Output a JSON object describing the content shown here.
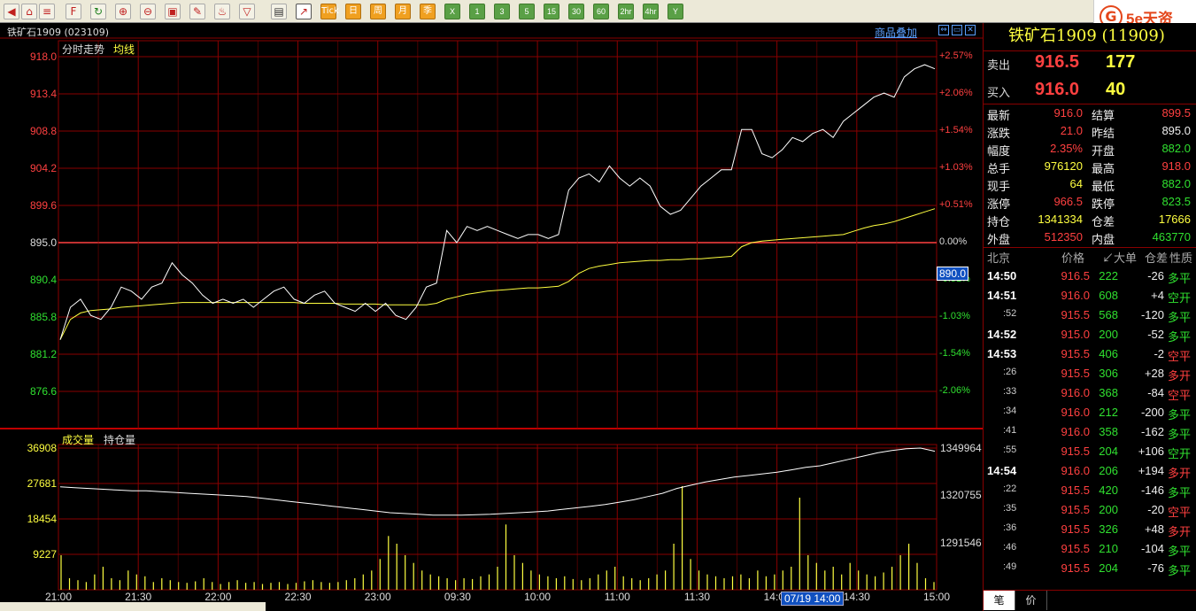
{
  "toolbar": {
    "period_buttons": [
      "Tick",
      "日",
      "周",
      "月",
      "季",
      "X",
      "1",
      "3",
      "5",
      "15",
      "30",
      "60",
      "2hr",
      "4hr",
      "Y"
    ]
  },
  "logo": {
    "mark": "G",
    "text": "5e天资"
  },
  "chart_header": {
    "title": "铁矿石1909 (023109)",
    "overlay_link": "商品叠加",
    "trend_label": "分时走势",
    "avg_label": "均线",
    "volume_label": "成交量",
    "oi_label": "持仓量"
  },
  "colors": {
    "up": "#ff4040",
    "down": "#30e030",
    "avg": "#ffff40",
    "price": "#ffffff",
    "grid": "#8a0000"
  },
  "chart_data": [
    {
      "type": "line",
      "name": "price",
      "y_ticks": [
        "918.0",
        "913.4",
        "908.8",
        "904.2",
        "899.6",
        "895.0",
        "890.4",
        "885.8",
        "881.2",
        "876.6"
      ],
      "pct_ticks": [
        "+2.57%",
        "+2.06%",
        "+1.54%",
        "+1.03%",
        "+0.51%",
        "0.00%",
        "-0.51%",
        "-1.03%",
        "-1.54%",
        "-2.06%"
      ],
      "ylim": [
        872.0,
        918.0
      ],
      "base": 895.0,
      "x_ticks": [
        "21:00",
        "21:30",
        "22:00",
        "22:30",
        "23:00",
        "09:30",
        "10:00",
        "11:00",
        "11:30",
        "14:00",
        "14:30",
        "15:00"
      ],
      "price_series": [
        883,
        887,
        888,
        886,
        885.5,
        887,
        889.5,
        889,
        888,
        889.5,
        890,
        892.5,
        891,
        890,
        888.5,
        887.5,
        888,
        887.5,
        888,
        887,
        888,
        889,
        889.5,
        888,
        887.5,
        888.5,
        889,
        887.5,
        887,
        886.5,
        887.5,
        886.5,
        887.5,
        886,
        885.5,
        887,
        889.5,
        890,
        896.5,
        895,
        897,
        896.5,
        897,
        896.5,
        896,
        895.5,
        896,
        896,
        895.5,
        896,
        901.5,
        903,
        903.5,
        902.5,
        904.5,
        903,
        902,
        903,
        902,
        899.5,
        898.5,
        899,
        900.5,
        902,
        903,
        904,
        904,
        909,
        909,
        906,
        905.5,
        906.5,
        908,
        907.5,
        908.5,
        909,
        908,
        910,
        911,
        912,
        913,
        913.5,
        913,
        915.5,
        916.5,
        917,
        916.5
      ],
      "avg_series": [
        883,
        885.5,
        886.3,
        886.6,
        886.7,
        886.8,
        887.0,
        887.1,
        887.2,
        887.3,
        887.4,
        887.5,
        887.6,
        887.6,
        887.6,
        887.6,
        887.6,
        887.6,
        887.6,
        887.6,
        887.6,
        887.6,
        887.6,
        887.6,
        887.5,
        887.5,
        887.5,
        887.5,
        887.4,
        887.4,
        887.4,
        887.4,
        887.3,
        887.3,
        887.3,
        887.3,
        887.3,
        887.5,
        888.0,
        888.3,
        888.6,
        888.8,
        889.0,
        889.1,
        889.2,
        889.3,
        889.4,
        889.4,
        889.5,
        889.6,
        890.2,
        891.2,
        891.8,
        892.1,
        892.3,
        892.5,
        892.6,
        892.7,
        892.8,
        892.8,
        892.9,
        892.9,
        893.0,
        893.0,
        893.1,
        893.2,
        893.3,
        894.5,
        895.0,
        895.2,
        895.3,
        895.4,
        895.5,
        895.6,
        895.7,
        895.8,
        895.9,
        896.0,
        896.4,
        896.8,
        897.1,
        897.3,
        897.6,
        898.0,
        898.4,
        898.8,
        899.2
      ]
    },
    {
      "type": "bar",
      "name": "volume",
      "y_ticks": [
        "36908",
        "27681",
        "18454",
        "9227"
      ],
      "ylim": [
        0,
        36908
      ],
      "oi_ticks": [
        "1349964",
        "1320755",
        "1291546"
      ],
      "oi_ylim": [
        1262337,
        1349964
      ],
      "oi_series": [
        1326000,
        1325500,
        1325000,
        1324500,
        1324000,
        1323500,
        1323500,
        1323000,
        1322500,
        1322000,
        1321500,
        1321000,
        1320500,
        1320000,
        1319000,
        1318000,
        1317000,
        1316000,
        1315000,
        1314000,
        1313000,
        1312000,
        1311000,
        1310000,
        1309500,
        1309000,
        1308500,
        1308500,
        1308500,
        1308700,
        1309000,
        1309500,
        1310000,
        1310500,
        1311000,
        1312000,
        1313000,
        1314000,
        1315000,
        1316500,
        1318000,
        1320000,
        1322000,
        1325000,
        1327000,
        1329000,
        1330500,
        1332000,
        1333000,
        1334000,
        1335000,
        1336500,
        1338000,
        1339000,
        1341000,
        1343000,
        1345000,
        1347000,
        1348500,
        1349500,
        1349964,
        1348000
      ],
      "volume_series": [
        9000,
        3000,
        2500,
        2000,
        4000,
        6000,
        3000,
        2500,
        5000,
        4000,
        3500,
        2000,
        3000,
        2500,
        2000,
        1800,
        2200,
        3000,
        2000,
        1500,
        2000,
        2500,
        1800,
        2000,
        1500,
        1800,
        2000,
        1500,
        1800,
        2200,
        2500,
        2000,
        1800,
        2000,
        2500,
        3000,
        4000,
        5000,
        8000,
        14000,
        12000,
        9000,
        7000,
        5000,
        4000,
        3500,
        3000,
        2500,
        3000,
        2800,
        3500,
        4000,
        6000,
        17000,
        9000,
        7000,
        5000,
        4000,
        3500,
        3000,
        3500,
        2800,
        2500,
        3000,
        4000,
        5000,
        6000,
        3500,
        3000,
        2500,
        3000,
        4000,
        5000,
        12000,
        27000,
        8000,
        5000,
        4000,
        3500,
        3000,
        3500,
        4000,
        3000,
        5000,
        3500,
        4000,
        5000,
        6000,
        24000,
        9000,
        7000,
        5000,
        6000,
        4000,
        7000,
        5000,
        4000,
        3500,
        4500,
        6000,
        9000,
        12000,
        7000,
        3000,
        2000
      ]
    }
  ],
  "cursor": {
    "price": "890.0",
    "time": "07/19 14:00"
  },
  "panel": {
    "title": "铁矿石1909 (11909)",
    "sell_label": "卖出",
    "sell_price": "916.5",
    "sell_qty": "177",
    "buy_label": "买入",
    "buy_price": "916.0",
    "buy_qty": "40",
    "quote_rows": [
      {
        "l1": "最新",
        "v1": "916.0",
        "c1": "red",
        "l2": "结算",
        "v2": "899.5",
        "c2": "red"
      },
      {
        "l1": "涨跌",
        "v1": "21.0",
        "c1": "red",
        "l2": "昨结",
        "v2": "895.0",
        "c2": "white"
      },
      {
        "l1": "幅度",
        "v1": "2.35%",
        "c1": "red",
        "l2": "开盘",
        "v2": "882.0",
        "c2": "green"
      },
      {
        "l1": "总手",
        "v1": "976120",
        "c1": "yellow",
        "l2": "最高",
        "v2": "918.0",
        "c2": "red"
      },
      {
        "l1": "现手",
        "v1": "64",
        "c1": "yellow",
        "l2": "最低",
        "v2": "882.0",
        "c2": "green"
      },
      {
        "l1": "涨停",
        "v1": "966.5",
        "c1": "red",
        "l2": "跌停",
        "v2": "823.5",
        "c2": "green"
      },
      {
        "l1": "持仓",
        "v1": "1341334",
        "c1": "yellow",
        "l2": "仓差",
        "v2": "17666",
        "c2": "yellow"
      },
      {
        "l1": "外盘",
        "v1": "512350",
        "c1": "red",
        "l2": "内盘",
        "v2": "463770",
        "c2": "green"
      }
    ],
    "trades_header": [
      "北京",
      "价格",
      "↙大单",
      "仓差",
      "性质"
    ],
    "trades": [
      {
        "t": "14:50",
        "tb": true,
        "p": "916.5",
        "v": "222",
        "d": "-26",
        "n": "多平",
        "nc": "green"
      },
      {
        "t": "14:51",
        "tb": true,
        "p": "916.0",
        "v": "608",
        "d": "+4",
        "n": "空开",
        "nc": "green"
      },
      {
        "t": ":52",
        "tb": false,
        "p": "915.5",
        "v": "568",
        "d": "-120",
        "n": "多平",
        "nc": "green"
      },
      {
        "t": "14:52",
        "tb": true,
        "p": "915.0",
        "v": "200",
        "d": "-52",
        "n": "多平",
        "nc": "green"
      },
      {
        "t": "14:53",
        "tb": true,
        "p": "915.5",
        "v": "406",
        "d": "-2",
        "n": "空平",
        "nc": "red"
      },
      {
        "t": ":26",
        "tb": false,
        "p": "915.5",
        "v": "306",
        "d": "+28",
        "n": "多开",
        "nc": "red"
      },
      {
        "t": ":33",
        "tb": false,
        "p": "916.0",
        "v": "368",
        "d": "-84",
        "n": "空平",
        "nc": "red"
      },
      {
        "t": ":34",
        "tb": false,
        "p": "916.0",
        "v": "212",
        "d": "-200",
        "n": "多平",
        "nc": "green"
      },
      {
        "t": ":41",
        "tb": false,
        "p": "916.0",
        "v": "358",
        "d": "-162",
        "n": "多平",
        "nc": "green"
      },
      {
        "t": ":55",
        "tb": false,
        "p": "915.5",
        "v": "204",
        "d": "+106",
        "n": "空开",
        "nc": "green"
      },
      {
        "t": "14:54",
        "tb": true,
        "p": "916.0",
        "v": "206",
        "d": "+194",
        "n": "多开",
        "nc": "red"
      },
      {
        "t": ":22",
        "tb": false,
        "p": "915.5",
        "v": "420",
        "d": "-146",
        "n": "多平",
        "nc": "green"
      },
      {
        "t": ":35",
        "tb": false,
        "p": "915.5",
        "v": "200",
        "d": "-20",
        "n": "空平",
        "nc": "red"
      },
      {
        "t": ":36",
        "tb": false,
        "p": "915.5",
        "v": "326",
        "d": "+48",
        "n": "多开",
        "nc": "red"
      },
      {
        "t": ":46",
        "tb": false,
        "p": "915.5",
        "v": "210",
        "d": "-104",
        "n": "多平",
        "nc": "green"
      },
      {
        "t": ":49",
        "tb": false,
        "p": "915.5",
        "v": "204",
        "d": "-76",
        "n": "多平",
        "nc": "green"
      }
    ],
    "tabs": [
      "笔",
      "价"
    ]
  }
}
